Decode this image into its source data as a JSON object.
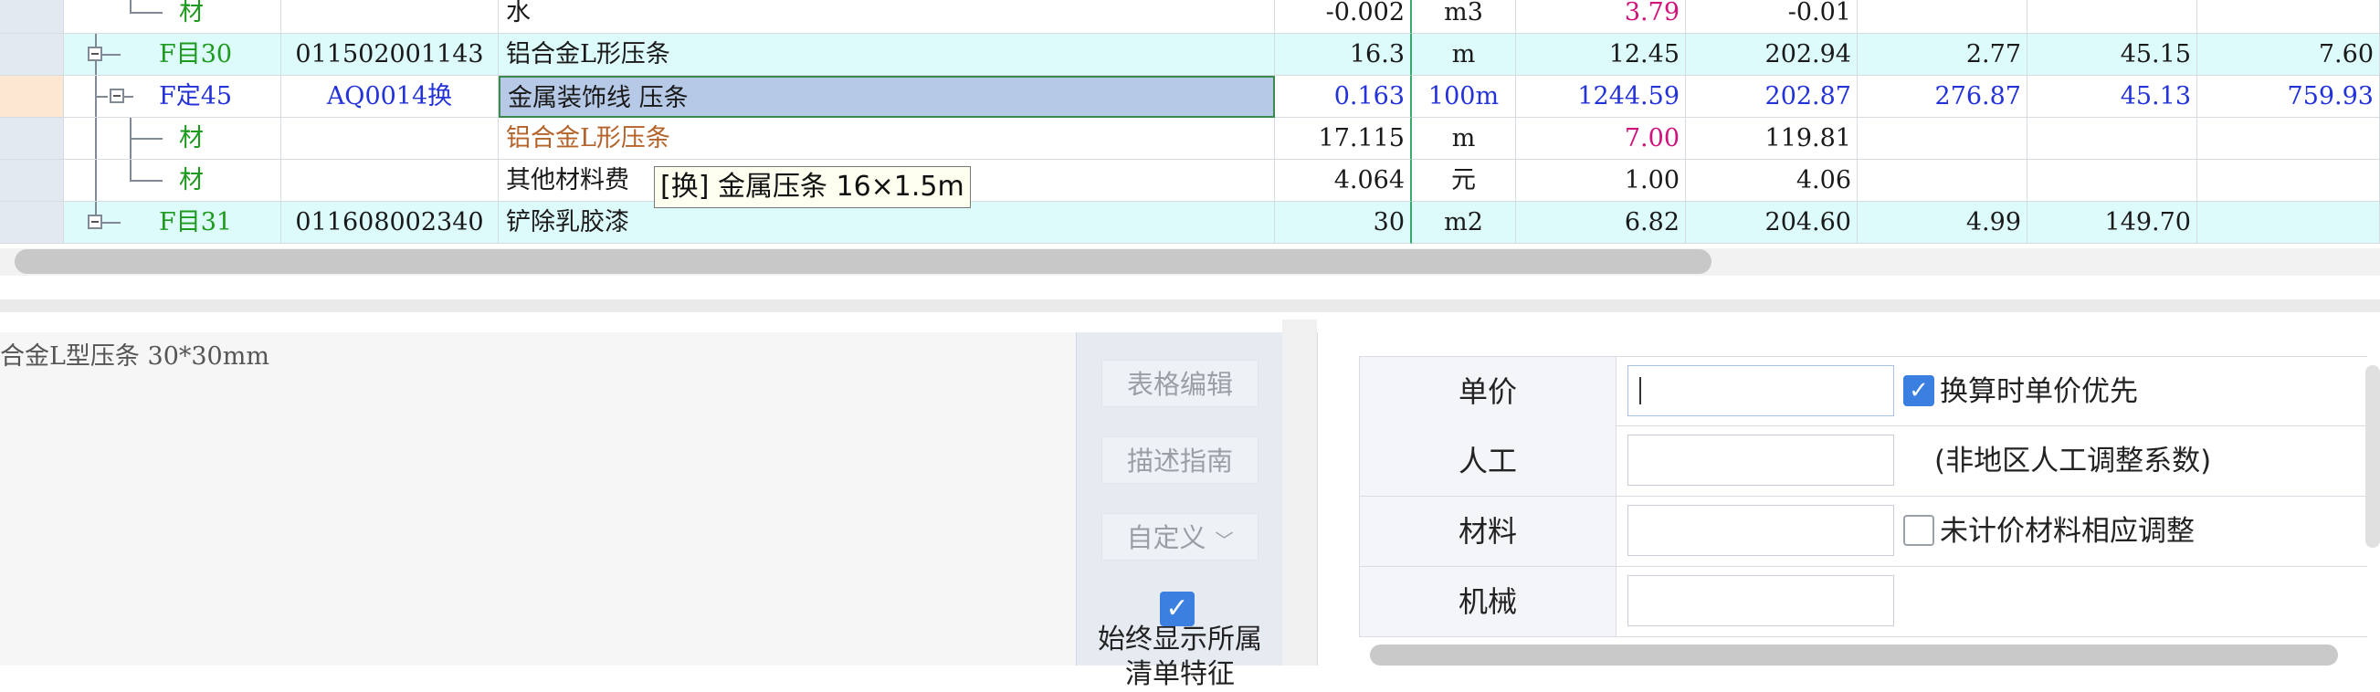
{
  "grid": {
    "rows": [
      {
        "type": "材",
        "code": "",
        "name": "水",
        "qty": "-0.002",
        "unit": "m3",
        "price": "3.79",
        "amount": "-0.01",
        "labor": "",
        "material": "",
        "total": ""
      },
      {
        "type": "F目30",
        "code": "011502001143",
        "name": "铝合金L形压条",
        "qty": "16.3",
        "unit": "m",
        "price": "12.45",
        "amount": "202.94",
        "labor": "2.77",
        "material": "45.15",
        "total": "7.60"
      },
      {
        "type": "F定45",
        "code": "AQ0014换",
        "name": "金属装饰线 压条",
        "qty": "0.163",
        "unit": "100m",
        "price": "1244.59",
        "amount": "202.87",
        "labor": "276.87",
        "material": "45.13",
        "total": "759.93"
      },
      {
        "type": "材",
        "code": "",
        "name": "铝合金L形压条",
        "qty": "17.115",
        "unit": "m",
        "price": "7.00",
        "amount": "119.81",
        "labor": "",
        "material": "",
        "total": ""
      },
      {
        "type": "材",
        "code": "",
        "name": "其他材料费",
        "qty": "4.064",
        "unit": "元",
        "price": "1.00",
        "amount": "4.06",
        "labor": "",
        "material": "",
        "total": ""
      },
      {
        "type": "F目31",
        "code": "011608002340",
        "name": "铲除乳胶漆",
        "qty": "30",
        "unit": "m2",
        "price": "6.82",
        "amount": "204.60",
        "labor": "4.99",
        "material": "149.70",
        "total": ""
      }
    ],
    "tooltip": "[换] 金属压条 16×1.5m"
  },
  "description": {
    "text": "合金L型压条 30*30mm",
    "btn_table_edit": "表格编辑",
    "btn_guide": "描述指南",
    "btn_custom": "自定义",
    "show_all_label": "始终显示所属清单特征",
    "show_all_checked": true
  },
  "adjust": {
    "unit_price_label": "单价",
    "labor_label": "人工",
    "material_label": "材料",
    "machine_label": "机械",
    "unit_price_value": "",
    "labor_value": "",
    "material_value": "",
    "machine_value": "",
    "priority_label": "换算时单价优先",
    "priority_checked": true,
    "labor_note": "(非地区人工调整系数)",
    "unpriced_label": "未计价材料相应调整",
    "unpriced_checked": false
  },
  "colors": {
    "accent": "#3b7fe0",
    "selection": "#b6c9e6",
    "list_row": "#ddfbfb",
    "link_blue": "#2433d9",
    "price_pink": "#d0127a",
    "material_brown": "#b4632a",
    "tree_green": "#1e9a1e"
  }
}
